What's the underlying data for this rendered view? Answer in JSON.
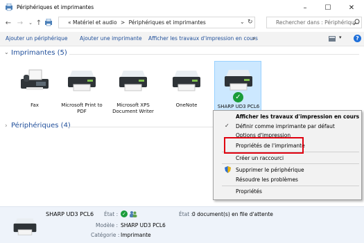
{
  "window": {
    "title": "Périphériques et imprimantes"
  },
  "address": {
    "prefix": "«",
    "crumb1": "Matériel et audio",
    "sep": ">",
    "crumb2": "Périphériques et imprimantes",
    "search_placeholder": "Rechercher dans : Périphériqu..."
  },
  "toolbar": {
    "add_device": "Ajouter un périphérique",
    "add_printer": "Ajouter une imprimante",
    "show_jobs": "Afficher les travaux d'impression en cours",
    "more": "»"
  },
  "groups": {
    "printers": {
      "label": "Imprimantes (5)"
    },
    "devices": {
      "label": "Périphériques (4)"
    }
  },
  "printers": [
    {
      "label": "Fax"
    },
    {
      "label": "Microsoft Print to PDF"
    },
    {
      "label": "Microsoft XPS Document Writer"
    },
    {
      "label": "OneNote"
    },
    {
      "label": "SHARP UD3 PCL6"
    }
  ],
  "context_menu": {
    "item0": "Afficher les travaux d'impression en cours",
    "item1": "Définir comme imprimante par défaut",
    "item2": "Options d'impression",
    "item3": "Propriétés de l'imprimante",
    "item4": "Créer un raccourci",
    "item5": "Supprimer le périphérique",
    "item6": "Résoudre les problèmes",
    "item7": "Propriétés"
  },
  "status": {
    "name": "SHARP UD3 PCL6",
    "etat_label": "État :",
    "etat2_label": "État :",
    "etat2_value": "0 document(s) en file d'attente",
    "modele_label": "Modèle :",
    "modele_value": "SHARP UD3 PCL6",
    "categorie_label": "Catégorie :",
    "categorie_value": "Imprimante"
  },
  "colors": {
    "accent": "#1f4e9a",
    "highlight_box": "#e0000f",
    "selection": "#cce8ff",
    "check_green": "#1a9c3a"
  }
}
